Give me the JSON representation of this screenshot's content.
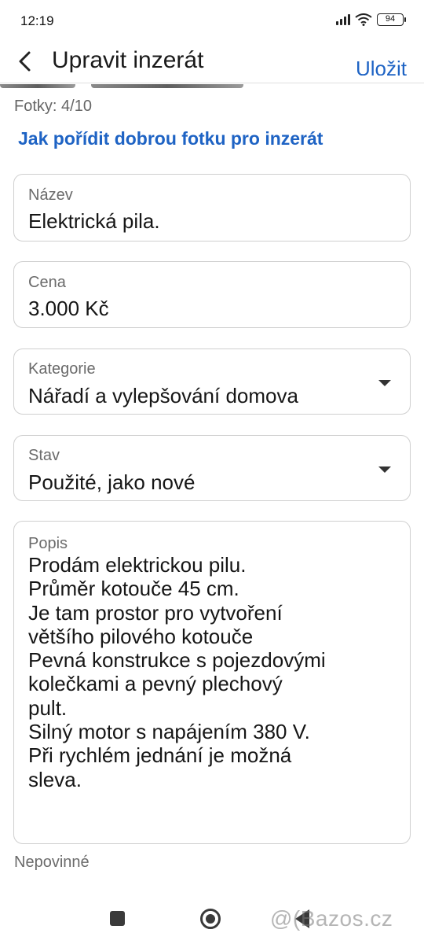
{
  "status_bar": {
    "time": "12:19",
    "battery": "94"
  },
  "app_bar": {
    "title": "Upravit inzerát",
    "save_label": "Uložit"
  },
  "photos": {
    "count_label": "Fotky: 4/10",
    "help_link": "Jak pořídit dobrou fotku pro inzerát"
  },
  "form": {
    "name": {
      "label": "Název",
      "value": "Elektrická pila."
    },
    "price": {
      "label": "Cena",
      "value": "3.000 Kč"
    },
    "category": {
      "label": "Kategorie",
      "value": "Nářadí a vylepšování domova"
    },
    "condition": {
      "label": "Stav",
      "value": "Použité, jako nové"
    },
    "description": {
      "label": "Popis",
      "value": "Prodám elektrickou pilu.\nPrůměr kotouče 45 cm.\nJe tam prostor pro vytvoření\nvětšího  pilového kotouče\nPevná konstrukce s pojezdovými\nkolečkami a pevný plechový\npult.\nSilný motor s napájením 380  V.\nPři rychlém jednání je možná\nsleva."
    },
    "optional_note": "Nepovinné"
  },
  "watermark": "@(Bazos.cz",
  "colors": {
    "accent": "#1e63c4",
    "border": "#cfcfcf",
    "label": "#6b6b6b"
  },
  "icons": {
    "back": "arrow-left-icon",
    "dropdown": "chevron-down-icon",
    "wifi": "wifi-icon",
    "signal": "signal-icon",
    "battery": "battery-icon"
  }
}
